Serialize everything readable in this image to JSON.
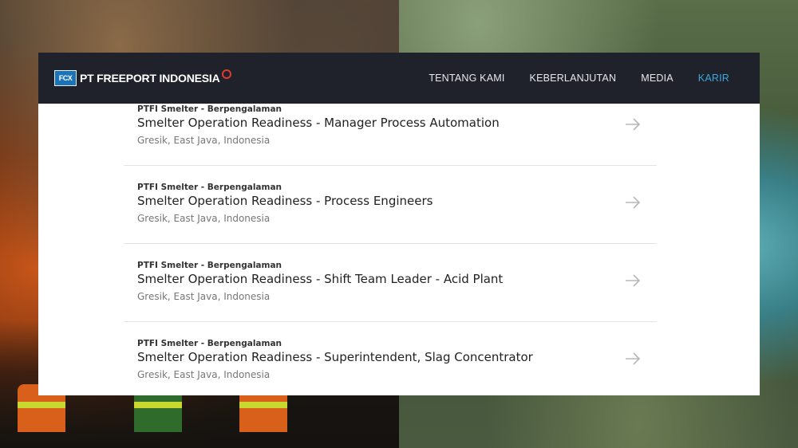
{
  "header": {
    "logo_mark": "FCX",
    "logo_text": "PT FREEPORT INDONESIA",
    "nav": [
      {
        "label": "TENTANG KAMI",
        "active": false
      },
      {
        "label": "KEBERLANJUTAN",
        "active": false
      },
      {
        "label": "MEDIA",
        "active": false
      },
      {
        "label": "KARIR",
        "active": true
      }
    ]
  },
  "jobs": [
    {
      "meta": "PTFI Smelter - Berpengalaman",
      "title": "Smelter Operation Readiness - Manager Process Automation",
      "location": "Gresik, East Java, Indonesia"
    },
    {
      "meta": "PTFI Smelter - Berpengalaman",
      "title": "Smelter Operation Readiness - Process Engineers",
      "location": "Gresik, East Java, Indonesia"
    },
    {
      "meta": "PTFI Smelter - Berpengalaman",
      "title": "Smelter Operation Readiness - Shift Team Leader - Acid Plant",
      "location": "Gresik, East Java, Indonesia"
    },
    {
      "meta": "PTFI Smelter - Berpengalaman",
      "title": "Smelter Operation Readiness - Superintendent, Slag Concentrator",
      "location": "Gresik, East Java, Indonesia"
    }
  ],
  "colors": {
    "header_bg": "#1f222a",
    "nav_active": "#3ba8e0",
    "arrow": "#b8b8b8"
  },
  "icons": {
    "job_link": "arrow-right-icon",
    "logo_emblem": "freeport-emblem-icon"
  }
}
